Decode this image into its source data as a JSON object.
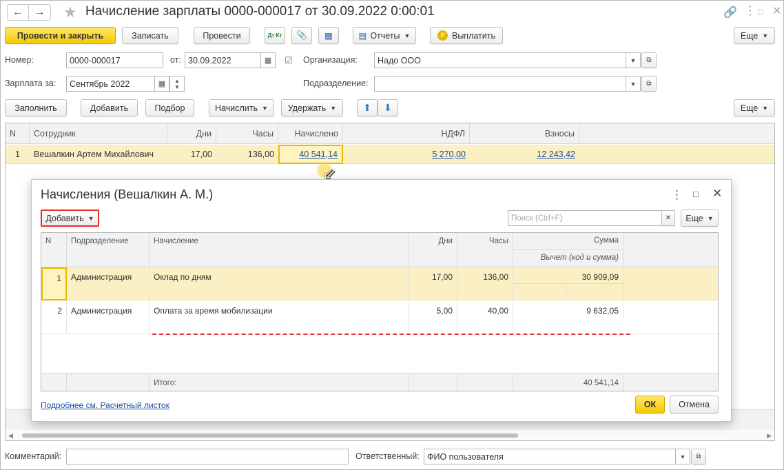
{
  "window": {
    "title": "Начисление зарплаты 0000-000017 от 30.09.2022 0:00:01"
  },
  "toolbar": {
    "post_close": "Провести и закрыть",
    "save": "Записать",
    "post": "Провести",
    "dt_kt": "Дт Кт",
    "reports": "Отчеты",
    "pay": "Выплатить",
    "more": "Еще"
  },
  "form": {
    "number_label": "Номер:",
    "number_value": "0000-000017",
    "from_label": "от:",
    "date_value": "30.09.2022",
    "org_label": "Организация:",
    "org_value": "Надо ООО",
    "salary_label": "Зарплата за:",
    "salary_value": "Сентябрь 2022",
    "dept_label": "Подразделение:",
    "dept_value": ""
  },
  "table_toolbar": {
    "fill": "Заполнить",
    "add": "Добавить",
    "select": "Подбор",
    "accrue": "Начислить",
    "withhold": "Удержать",
    "more": "Еще"
  },
  "grid": {
    "columns": [
      "N",
      "Сотрудник",
      "Дни",
      "Часы",
      "Начислено",
      "НДФЛ",
      "Взносы"
    ],
    "rows": [
      {
        "n": "1",
        "employee": "Вешалкин Артем Михайлович",
        "days": "17,00",
        "hours": "136,00",
        "accrued": "40 541,14",
        "ndfl": "5 270,00",
        "contributions": "12 243,42"
      }
    ]
  },
  "dialog": {
    "title": "Начисления (Вешалкин А. М.)",
    "add": "Добавить",
    "search_placeholder": "Поиск (Ctrl+F)",
    "more": "Еще",
    "columns": {
      "n": "N",
      "dept": "Подразделение",
      "accrual": "Начисление",
      "days": "Дни",
      "hours": "Часы",
      "sum": "Сумма",
      "deduction": "Вычет (код и сумма)"
    },
    "rows": [
      {
        "n": "1",
        "dept": "Администрация",
        "accrual": "Оклад по дням",
        "days": "17,00",
        "hours": "136,00",
        "sum": "30 909,09"
      },
      {
        "n": "2",
        "dept": "Администрация",
        "accrual": "Оплата за время мобилизации",
        "days": "5,00",
        "hours": "40,00",
        "sum": "9 632,05"
      }
    ],
    "total_label": "Итого:",
    "total_sum": "40 541,14",
    "payslip_link": "Подробнее см. Расчетный листок",
    "ok": "ОК",
    "cancel": "Отмена"
  },
  "bottom": {
    "comment_label": "Комментарий:",
    "comment_value": "",
    "responsible_label": "Ответственный:",
    "responsible_value": "ФИО пользователя"
  },
  "colors": {
    "primary_button": "#f5c800",
    "selected_row": "#fbefc4",
    "link": "#1a4f9c",
    "highlight_border": "#e53030"
  }
}
